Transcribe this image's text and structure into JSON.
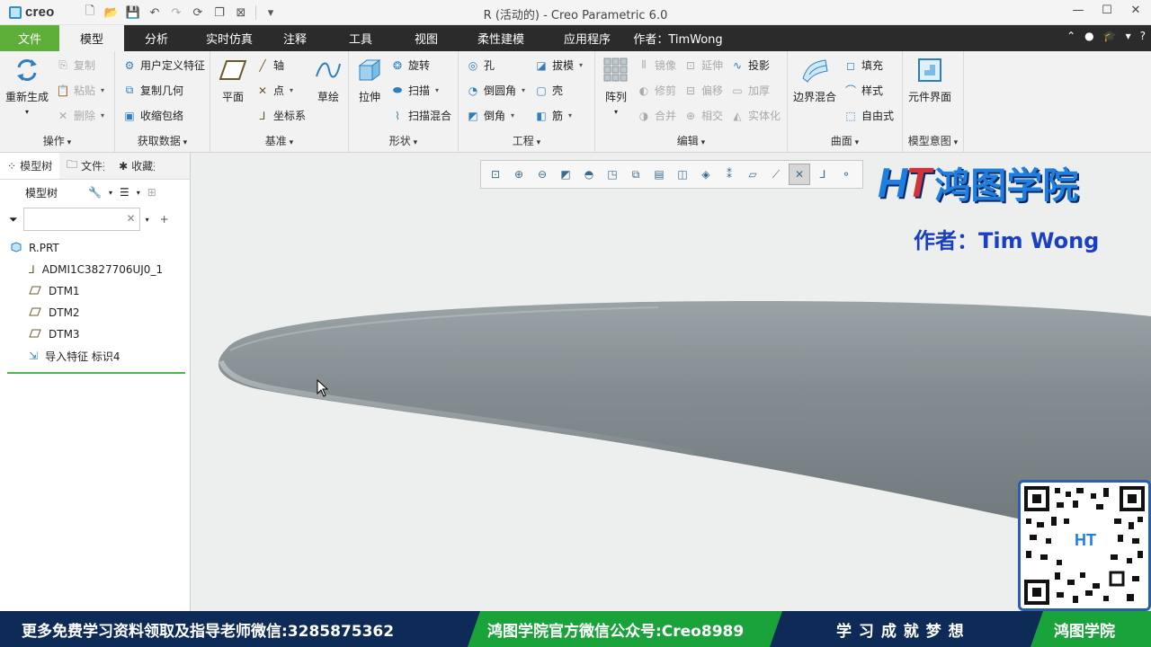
{
  "titlebar": {
    "app_logo": "creo",
    "title": "R (活动的) - Creo Parametric 6.0"
  },
  "tabs": [
    {
      "label": "文件"
    },
    {
      "label": "模型"
    },
    {
      "label": "分析"
    },
    {
      "label": "实时仿真"
    },
    {
      "label": "注释"
    },
    {
      "label": "工具"
    },
    {
      "label": "视图"
    },
    {
      "label": "柔性建模"
    },
    {
      "label": "应用程序"
    },
    {
      "label": "作者：TimWong"
    }
  ],
  "ribbon": {
    "ops": {
      "label": "操作",
      "regen": "重新生成",
      "copy": "复制",
      "paste": "粘贴",
      "delete": "删除"
    },
    "getdata": {
      "label": "获取数据",
      "udf": "用户定义特征",
      "copygeom": "复制几何",
      "shrinkwrap": "收缩包络"
    },
    "datum": {
      "label": "基准",
      "plane": "平面",
      "axis": "轴",
      "point": "点",
      "csys": "坐标系",
      "sketch": "草绘"
    },
    "shapes": {
      "label": "形状",
      "extrude": "拉伸",
      "revolve": "旋转",
      "sweep": "扫描",
      "sweepblend": "扫描混合"
    },
    "engineering": {
      "label": "工程",
      "hole": "孔",
      "round": "倒圆角",
      "chamfer": "倒角",
      "draft": "拔模",
      "shell": "壳",
      "rib": "筋"
    },
    "editing": {
      "label": "编辑",
      "pattern": "阵列",
      "mirror": "镜像",
      "extend": "延伸",
      "project": "投影",
      "trim": "修剪",
      "offset": "偏移",
      "thicken": "加厚",
      "merge": "合并",
      "intersect": "相交",
      "solidify": "实体化"
    },
    "surfaces": {
      "label": "曲面",
      "boundary": "边界混合",
      "fill": "填充",
      "style": "样式",
      "freestyle": "自由式"
    },
    "intent": {
      "label": "模型意图",
      "component": "元件界面"
    }
  },
  "panel": {
    "tabs": [
      "模型树",
      "文件夹",
      "收藏夹"
    ],
    "tree_label": "模型树",
    "search_placeholder": "",
    "nodes": [
      {
        "label": "R.PRT",
        "icon": "part-icon"
      },
      {
        "label": "ADMI1C3827706UJ0_1",
        "icon": "csys-icon"
      },
      {
        "label": "DTM1",
        "icon": "datum-plane-icon"
      },
      {
        "label": "DTM2",
        "icon": "datum-plane-icon"
      },
      {
        "label": "DTM3",
        "icon": "datum-plane-icon"
      },
      {
        "label": "导入特征 标识4",
        "icon": "import-feature-icon"
      }
    ]
  },
  "brand": {
    "name": "鸿图学院",
    "author": "作者：Tim Wong"
  },
  "banner": {
    "left": "更多免费学习资料领取及指导老师微信:3285875362",
    "middle": "鸿图学院官方微信公众号:Creo8989",
    "slogan": "学 习 成 就 梦 想",
    "right": "鸿图学院"
  },
  "colors": {
    "file_tab": "#5eae3a",
    "tab_bar": "#2b2b2b",
    "banner_bg": "#0e2a57",
    "banner_green": "#1aa33a",
    "model_surface": "#7f8a8d"
  }
}
